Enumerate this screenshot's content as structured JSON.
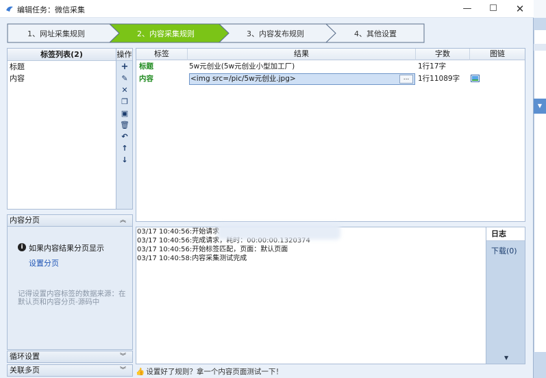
{
  "window": {
    "title": "编辑任务：微信采集",
    "minimize": "—",
    "maximize": "☐",
    "close": "✕"
  },
  "steps": [
    {
      "label": "1、网址采集规则",
      "active": false
    },
    {
      "label": "2、内容采集规则",
      "active": true
    },
    {
      "label": "3、内容发布规则",
      "active": false
    },
    {
      "label": "4、其他设置",
      "active": false
    }
  ],
  "tag_list": {
    "header": "标签列表(2)",
    "items": [
      "标题",
      "内容"
    ]
  },
  "ops": {
    "header": "操作",
    "icons": [
      "plus-icon",
      "edit-icon",
      "delete-icon",
      "copy-icon",
      "paste-icon",
      "trash-icon",
      "undo-icon",
      "arrow-up-icon",
      "arrow-down-icon"
    ]
  },
  "results": {
    "columns": [
      "标签",
      "结果",
      "字数",
      "图链"
    ],
    "rows": [
      {
        "tag": "标题",
        "result": "5w元创业(5w元创业小型加工厂)",
        "count": "1行17字",
        "has_image": false
      },
      {
        "tag": "内容",
        "result": "<img src=/pic/5w元创业.jpg>",
        "count": "1行11089字",
        "has_image": true
      }
    ],
    "more_button": "..."
  },
  "paging": {
    "header": "内容分页",
    "info": "如果内容结果分页显示",
    "link": "设置分页",
    "hint": "记得设置内容标签的数据来源：在默认页和内容分页-源码中"
  },
  "loop": {
    "header": "循环设置"
  },
  "related": {
    "header": "关联多页"
  },
  "log": {
    "lines": [
      "03/17 10:40:56:开始请求",
      "03/17 10:40:56:完成请求，耗时：00:00:00.1320374",
      "03/17 10:40:56:开始标签匹配，页面：默认页面",
      "03/17 10:40:58:内容采集测试完成"
    ]
  },
  "side_tabs": {
    "log": "日志",
    "download": "下载(0)"
  },
  "status": {
    "text": "设置好了规则？拿一个内容页面测试一下！"
  },
  "colors": {
    "active_step": "#7bc417",
    "tag_green": "#1f8a1f",
    "link_blue": "#1f55b5"
  }
}
